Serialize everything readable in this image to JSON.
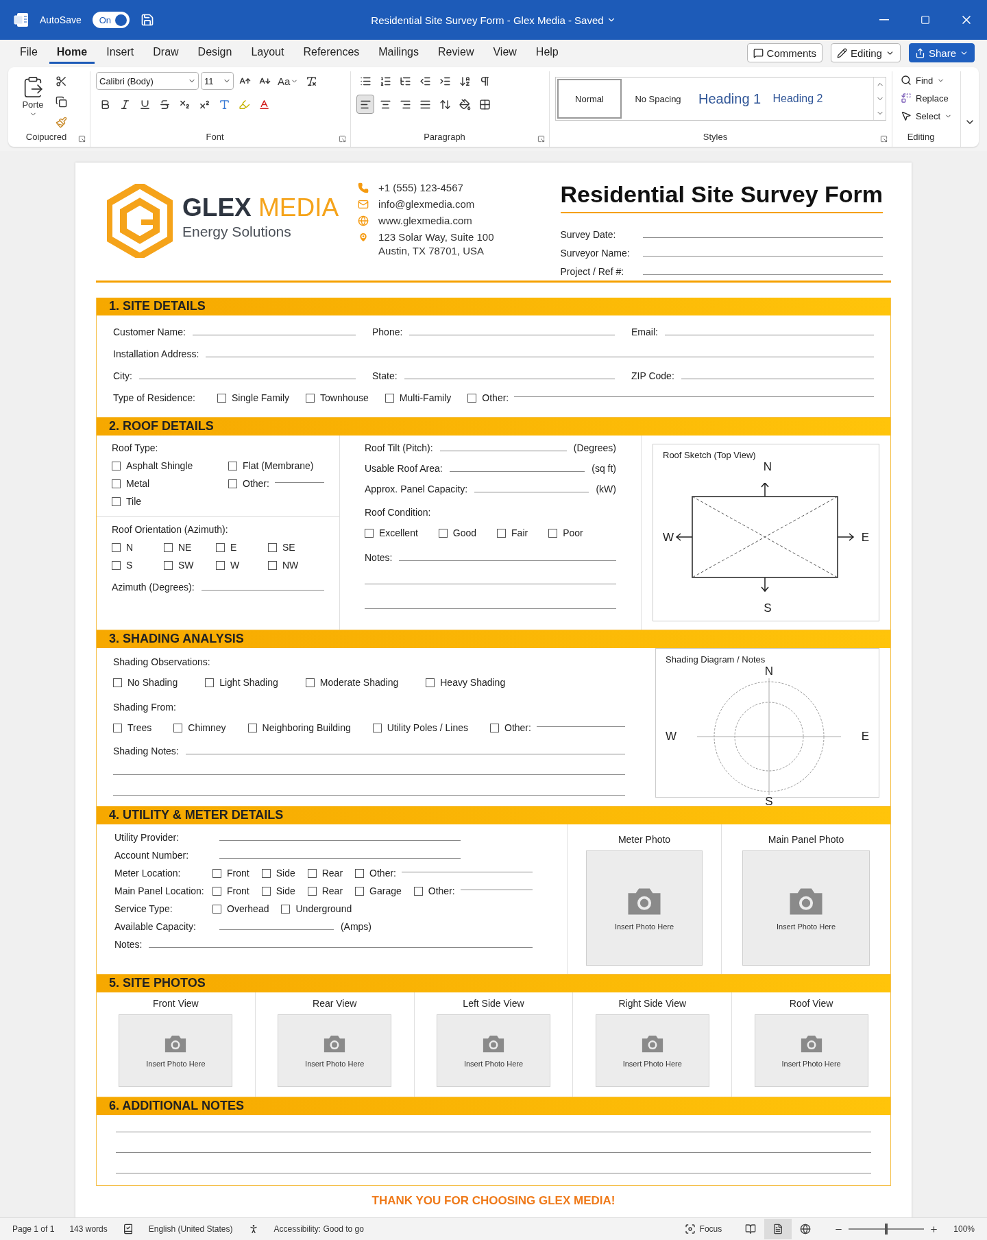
{
  "window": {
    "title": "Residential Site Survey Form - Glex Media - Saved",
    "autosave": {
      "label": "AutoSave",
      "toggle": "On",
      "on": true
    }
  },
  "menu_tabs": [
    {
      "label": "File",
      "selected": false
    },
    {
      "label": "Home",
      "selected": true
    },
    {
      "label": "Insert",
      "selected": false
    },
    {
      "label": "Draw",
      "selected": false
    },
    {
      "label": "Design",
      "selected": false
    },
    {
      "label": "Layout",
      "selected": false
    },
    {
      "label": "References",
      "selected": false
    },
    {
      "label": "Mailings",
      "selected": false
    },
    {
      "label": "Review",
      "selected": false
    },
    {
      "label": "View",
      "selected": false
    },
    {
      "label": "Help",
      "selected": false
    }
  ],
  "top_buttons": [
    {
      "kind": "comments",
      "label": "Comments"
    },
    {
      "kind": "editing",
      "label": "Editing"
    },
    {
      "kind": "share",
      "label": "Share"
    }
  ],
  "ribbon": {
    "clipboard": {
      "paste": "Porte",
      "group": "Coipucred"
    },
    "font": {
      "name": "Calibri (Body)",
      "size": "11",
      "change_case": "Aa",
      "group": "Font"
    },
    "paragraph": {
      "group": "Paragraph",
      "alignment": [
        {
          "kind": "left",
          "selected": true
        },
        {
          "kind": "center",
          "selected": false
        },
        {
          "kind": "right",
          "selected": false
        },
        {
          "kind": "justify",
          "selected": false
        }
      ]
    },
    "styles": {
      "group": "Styles",
      "items": [
        {
          "kind": "normal",
          "label": "Normal",
          "selected": true
        },
        {
          "kind": "plain",
          "label": "No Spacing",
          "selected": false
        },
        {
          "kind": "heading1",
          "label": "Heading 1",
          "selected": false
        },
        {
          "kind": "heading2",
          "label": "Heading 2",
          "selected": false
        }
      ]
    },
    "editing": {
      "group": "Editing",
      "items": [
        {
          "kind": "find",
          "label": "Find"
        },
        {
          "kind": "replace",
          "label": "Replace"
        },
        {
          "kind": "select",
          "label": "Select"
        }
      ]
    }
  },
  "document": {
    "header": {
      "brand": {
        "name": "**GLEX** MEDIA",
        "tagline": "Energy Solutions"
      },
      "contacts": [
        {
          "kind": "phone",
          "lines": [
            "+1 (555) 123-4567"
          ]
        },
        {
          "kind": "email",
          "lines": [
            "info@glexmedia.com"
          ]
        },
        {
          "kind": "web",
          "lines": [
            "www.glexmedia.com"
          ]
        },
        {
          "kind": "address",
          "lines": [
            "123 Solar Way, Suite 100",
            "Austin, TX 78701, USA"
          ]
        }
      ],
      "title": "Residential Site Survey Form",
      "fields": [
        {
          "kind": "field",
          "label": "Survey Date:"
        },
        {
          "kind": "field",
          "label": "Surveyor Name:"
        },
        {
          "kind": "field",
          "label": "Project / Ref #:"
        }
      ]
    },
    "site_details": {
      "heading": "1. SITE DETAILS",
      "rows": [
        [
          {
            "kind": "field",
            "label": "Customer Name:"
          },
          {
            "kind": "field",
            "label": "Phone:"
          },
          {
            "kind": "field",
            "label": "Email:"
          }
        ],
        [
          {
            "kind": "field",
            "label": "Installation Address:"
          }
        ],
        [
          {
            "kind": "field",
            "label": "City:"
          },
          {
            "kind": "field",
            "label": "State:"
          },
          {
            "kind": "field",
            "label": "ZIP Code:"
          }
        ],
        [
          {
            "kind": "label",
            "label": "Type of Residence:"
          },
          {
            "kind": "check",
            "label": "Single Family",
            "checked": false
          },
          {
            "kind": "check",
            "label": "Townhouse",
            "checked": false
          },
          {
            "kind": "check",
            "label": "Multi-Family",
            "checked": false
          },
          {
            "kind": "check_field",
            "label": "Other:",
            "checked": false
          }
        ]
      ]
    },
    "roof_details": {
      "heading": "2. ROOF DETAILS",
      "roof_type": {
        "label": "Roof Type:",
        "options": [
          {
            "kind": "check",
            "label": "Asphalt Shingle",
            "checked": false
          },
          {
            "kind": "check",
            "label": "Flat  (Membrane)",
            "checked": false
          },
          {
            "kind": "check",
            "label": "Metal",
            "checked": false
          },
          {
            "kind": "check_field",
            "label": "Other:",
            "checked": false
          },
          {
            "kind": "check",
            "label": "Tile",
            "checked": false
          }
        ]
      },
      "orientation": {
        "label": "Roof Orientation (Azimuth):",
        "options": [
          {
            "kind": "check",
            "label": "N",
            "checked": false
          },
          {
            "kind": "check",
            "label": "NE",
            "checked": false
          },
          {
            "kind": "check",
            "label": "E",
            "checked": false
          },
          {
            "kind": "check",
            "label": "SE",
            "checked": false
          },
          {
            "kind": "check",
            "label": "S",
            "checked": false
          },
          {
            "kind": "check",
            "label": "SW",
            "checked": false
          },
          {
            "kind": "check",
            "label": "W",
            "checked": false
          },
          {
            "kind": "check",
            "label": "NW",
            "checked": false
          }
        ]
      },
      "azimuth": {
        "kind": "field",
        "label": "Azimuth (Degrees):"
      },
      "measures": [
        {
          "kind": "field",
          "label": "Roof Tilt (Pitch):",
          "unit": "(Degrees)"
        },
        {
          "kind": "field",
          "label": "Usable Roof Area:",
          "unit": "(sq ft)"
        },
        {
          "kind": "field",
          "label": "Approx. Panel Capacity:",
          "unit": "(kW)"
        }
      ],
      "condition": {
        "label": "Roof Condition:",
        "options": [
          {
            "kind": "check",
            "label": "Excellent",
            "checked": false
          },
          {
            "kind": "check",
            "label": "Good",
            "checked": false
          },
          {
            "kind": "check",
            "label": "Fair",
            "checked": false
          },
          {
            "kind": "check",
            "label": "Poor",
            "checked": false
          }
        ]
      },
      "notes": {
        "kind": "field",
        "label": "Notes:"
      },
      "sketch": {
        "title": "Roof Sketch (Top View)",
        "north": "N",
        "west": "W",
        "east": "E",
        "south": "S"
      }
    },
    "shading": {
      "heading": "3. SHADING ANALYSIS",
      "observations": {
        "label": "Shading Observations:",
        "options": [
          {
            "kind": "check",
            "label": "No Shading",
            "checked": false
          },
          {
            "kind": "check",
            "label": "Light Shading",
            "checked": false
          },
          {
            "kind": "check",
            "label": "Moderate Shading",
            "checked": false
          },
          {
            "kind": "check",
            "label": "Heavy Shading",
            "checked": false
          }
        ]
      },
      "sources": {
        "label": "Shading From:",
        "options": [
          {
            "kind": "check",
            "label": "Trees",
            "checked": false
          },
          {
            "kind": "check",
            "label": "Chimney",
            "checked": false
          },
          {
            "kind": "check",
            "label": "Neighboring Building",
            "checked": false
          },
          {
            "kind": "check",
            "label": "Utility Poles / Lines",
            "checked": false
          },
          {
            "kind": "check_field",
            "label": "Other:",
            "checked": false
          }
        ]
      },
      "notes": {
        "kind": "field",
        "label": "Shading Notes:"
      },
      "diagram": {
        "title": "Shading Diagram / Notes",
        "north": "N",
        "west": "W",
        "east": "E",
        "south": "S"
      }
    },
    "utility": {
      "heading": "4. UTILITY & METER DETAILS",
      "rows": [
        {
          "kind": "field",
          "label": "Utility Provider:"
        },
        {
          "kind": "field",
          "label": "Account Number:"
        },
        {
          "kind": "options",
          "label": "Meter Location:",
          "options": [
            {
              "kind": "check",
              "label": "Front",
              "checked": false
            },
            {
              "kind": "check",
              "label": "Side",
              "checked": false
            },
            {
              "kind": "check",
              "label": "Rear",
              "checked": false
            },
            {
              "kind": "check_field",
              "label": "Other:",
              "checked": false
            }
          ]
        },
        {
          "kind": "options",
          "label": "Main Panel Location:",
          "options": [
            {
              "kind": "check",
              "label": "Front",
              "checked": false
            },
            {
              "kind": "check",
              "label": "Side",
              "checked": false
            },
            {
              "kind": "check",
              "label": "Rear",
              "checked": false
            },
            {
              "kind": "check",
              "label": "Garage",
              "checked": false
            },
            {
              "kind": "check_field",
              "label": "Other:",
              "checked": false
            }
          ]
        },
        {
          "kind": "options",
          "label": "Service Type:",
          "options": [
            {
              "kind": "check",
              "label": "Overhead",
              "checked": false
            },
            {
              "kind": "check",
              "label": "Underground",
              "checked": false
            }
          ]
        },
        {
          "kind": "field",
          "label": "Available Capacity:",
          "unit": "(Amps)"
        },
        {
          "kind": "field",
          "label": "Notes:"
        }
      ],
      "photos": [
        {
          "title": "Meter Photo",
          "placeholder": "Insert Photo Here"
        },
        {
          "title": "Main Panel Photo",
          "placeholder": "Insert Photo Here"
        }
      ]
    },
    "site_photos": {
      "heading": "5. SITE PHOTOS",
      "photos": [
        {
          "title": "Front View",
          "placeholder": "Insert Photo Here"
        },
        {
          "title": "Rear View",
          "placeholder": "Insert Photo Here"
        },
        {
          "title": "Left Side View",
          "placeholder": "Insert Photo Here"
        },
        {
          "title": "Right Side View",
          "placeholder": "Insert Photo Here"
        },
        {
          "title": "Roof View",
          "placeholder": "Insert Photo Here"
        }
      ]
    },
    "additional_notes": {
      "heading": "6. ADDITIONAL NOTES"
    },
    "footer": "THANK YOU FOR CHOOSING GLEX MEDIA!"
  },
  "status_bar": {
    "page": "Page 1 of 1",
    "words": "143 words",
    "language": "English (United States)",
    "accessibility": "Accessibility: Good to go",
    "focus": "Focus",
    "views": [
      {
        "kind": "read",
        "selected": false
      },
      {
        "kind": "print",
        "selected": true
      },
      {
        "kind": "web",
        "selected": false
      }
    ],
    "zoom": {
      "level": 0.5,
      "reading": "100%"
    }
  }
}
